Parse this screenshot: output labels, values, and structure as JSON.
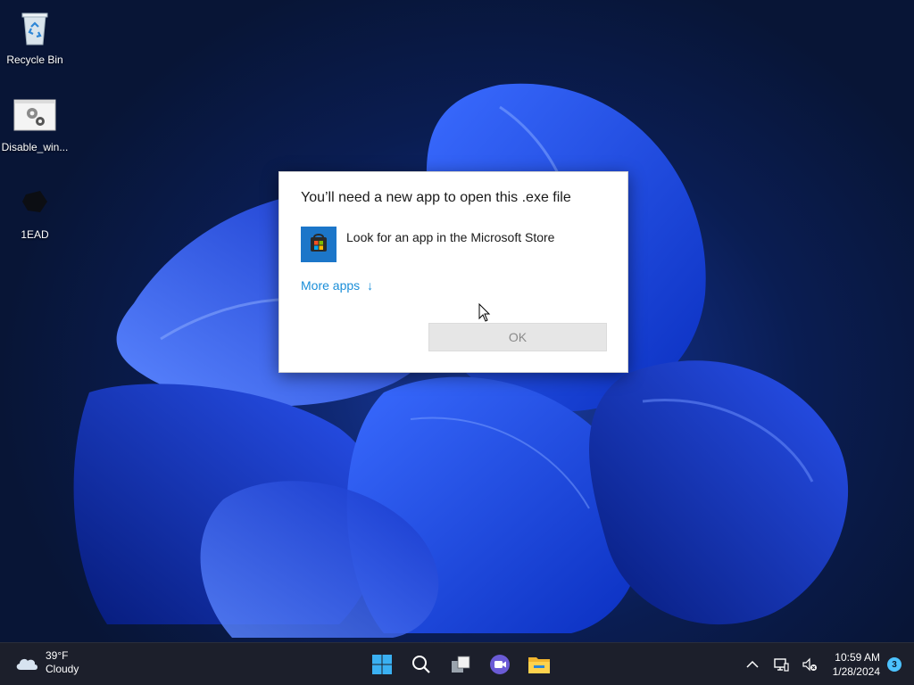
{
  "desktop": {
    "icons": [
      {
        "label": "Recycle Bin"
      },
      {
        "label": "Disable_win..."
      },
      {
        "label": "1EAD"
      }
    ]
  },
  "dialog": {
    "title": "You’ll need a new app to open this .exe file",
    "store_option_label": "Look for an app in the Microsoft Store",
    "more_apps_label": "More apps",
    "more_apps_arrow": "↓",
    "ok_label": "OK"
  },
  "taskbar": {
    "weather": {
      "temp": "39°F",
      "condition": "Cloudy",
      "icon": "cloud-icon"
    },
    "center_icons": [
      "start-icon",
      "search-icon",
      "task-view-icon",
      "meet-icon",
      "file-explorer-icon"
    ],
    "tray": {
      "chevron": "^",
      "time": "10:59 AM",
      "date": "1/28/2024",
      "notification_count": "3"
    }
  },
  "colors": {
    "accent": "#1a8ed8",
    "taskbar": "#1c1f2b",
    "badge": "#4cc2ff"
  }
}
